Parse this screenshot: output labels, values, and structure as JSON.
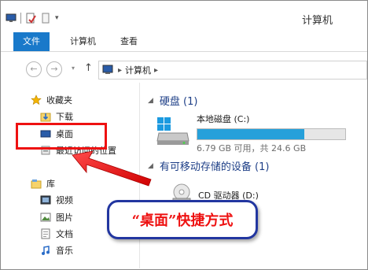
{
  "window": {
    "title": "计算机",
    "accent": "#1979ca"
  },
  "ribbon": {
    "tabs": [
      {
        "label": "文件"
      },
      {
        "label": "计算机"
      },
      {
        "label": "查看"
      }
    ]
  },
  "navigation": {
    "back_icon": "back-arrow-icon",
    "forward_icon": "forward-arrow-icon",
    "up_icon": "up-arrow-icon"
  },
  "address_bar": {
    "icon": "computer-icon",
    "crumb": "计算机"
  },
  "sidebar": {
    "favorites": {
      "label": "收藏夹",
      "icon": "star-icon",
      "items": [
        {
          "label": "下载",
          "icon": "downloads-folder-icon"
        },
        {
          "label": "桌面",
          "icon": "desktop-icon"
        },
        {
          "label": "最近访问的位置",
          "icon": "recent-places-icon"
        }
      ]
    },
    "libraries": {
      "label": "库",
      "icon": "library-icon",
      "items": [
        {
          "label": "视频",
          "icon": "video-icon"
        },
        {
          "label": "图片",
          "icon": "pictures-icon"
        },
        {
          "label": "文档",
          "icon": "documents-icon"
        },
        {
          "label": "音乐",
          "icon": "music-icon"
        }
      ]
    }
  },
  "content": {
    "hard_disks": {
      "label": "硬盘 (1)",
      "drives": [
        {
          "name": "本地磁盘 (C:)",
          "space": "6.79 GB 可用，共 24.6 GB",
          "used_fraction": 0.724
        }
      ]
    },
    "removable": {
      "label": "有可移动存储的设备 (1)",
      "devices": [
        {
          "name": "CD 驱动器 (D:)",
          "icon": "cd-drive-icon"
        }
      ]
    }
  },
  "annotation": {
    "callout_text": "“桌面”快捷方式",
    "highlight_color": "#e11111",
    "callout_border_color": "#2236a0"
  }
}
